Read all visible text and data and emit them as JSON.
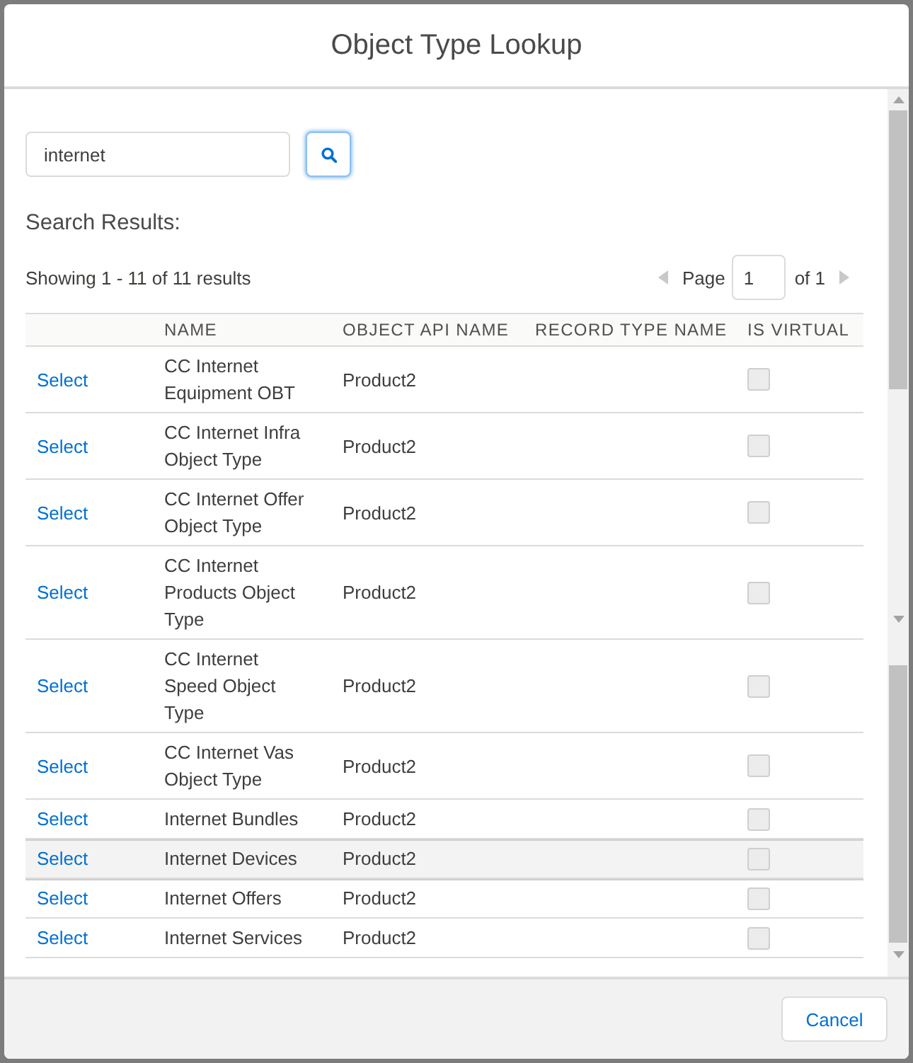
{
  "dialog": {
    "title": "Object Type Lookup"
  },
  "search": {
    "value": "internet"
  },
  "results": {
    "heading": "Search Results:",
    "summary": "Showing 1 - 11 of 11 results"
  },
  "pagination": {
    "prev": {
      "disabled": true
    },
    "label": "Page",
    "page": "1",
    "total": "of 1",
    "next": {
      "disabled": true
    }
  },
  "table": {
    "columns": [
      "NAME",
      "OBJECT API NAME",
      "RECORD TYPE NAME",
      "IS VIRTUAL"
    ],
    "rows": [
      {
        "action": "Select",
        "name": "CC Internet Equipment OBT",
        "object_api_name": "Product2",
        "is_virtual": {
          "checked": false,
          "disabled": true
        },
        "selected": false
      },
      {
        "action": "Select",
        "name": "CC Internet Infra Object Type",
        "object_api_name": "Product2",
        "is_virtual": {
          "checked": false,
          "disabled": true
        },
        "selected": false
      },
      {
        "action": "Select",
        "name": "CC Internet Offer Object Type",
        "object_api_name": "Product2",
        "is_virtual": {
          "checked": false,
          "disabled": true
        },
        "selected": false
      },
      {
        "action": "Select",
        "name": "CC Internet Products Object Type",
        "object_api_name": "Product2",
        "is_virtual": {
          "checked": false,
          "disabled": true
        },
        "selected": false
      },
      {
        "action": "Select",
        "name": "CC Internet Speed Object Type",
        "object_api_name": "Product2",
        "is_virtual": {
          "checked": false,
          "disabled": true
        },
        "selected": false
      },
      {
        "action": "Select",
        "name": "CC Internet Vas Object Type",
        "object_api_name": "Product2",
        "is_virtual": {
          "checked": false,
          "disabled": true
        },
        "selected": false
      },
      {
        "action": "Select",
        "name": "Internet Bundles",
        "object_api_name": "Product2",
        "is_virtual": {
          "checked": false,
          "disabled": true
        },
        "selected": false
      },
      {
        "action": "Select",
        "name": "Internet Devices",
        "object_api_name": "Product2",
        "is_virtual": {
          "checked": false,
          "disabled": true
        },
        "selected": true
      },
      {
        "action": "Select",
        "name": "Internet Offers",
        "object_api_name": "Product2",
        "is_virtual": {
          "checked": false,
          "disabled": true
        },
        "selected": false
      },
      {
        "action": "Select",
        "name": "Internet Services",
        "object_api_name": "Product2",
        "is_virtual": {
          "checked": false,
          "disabled": true
        },
        "selected": false
      }
    ]
  },
  "footer": {
    "cancel": "Cancel"
  }
}
